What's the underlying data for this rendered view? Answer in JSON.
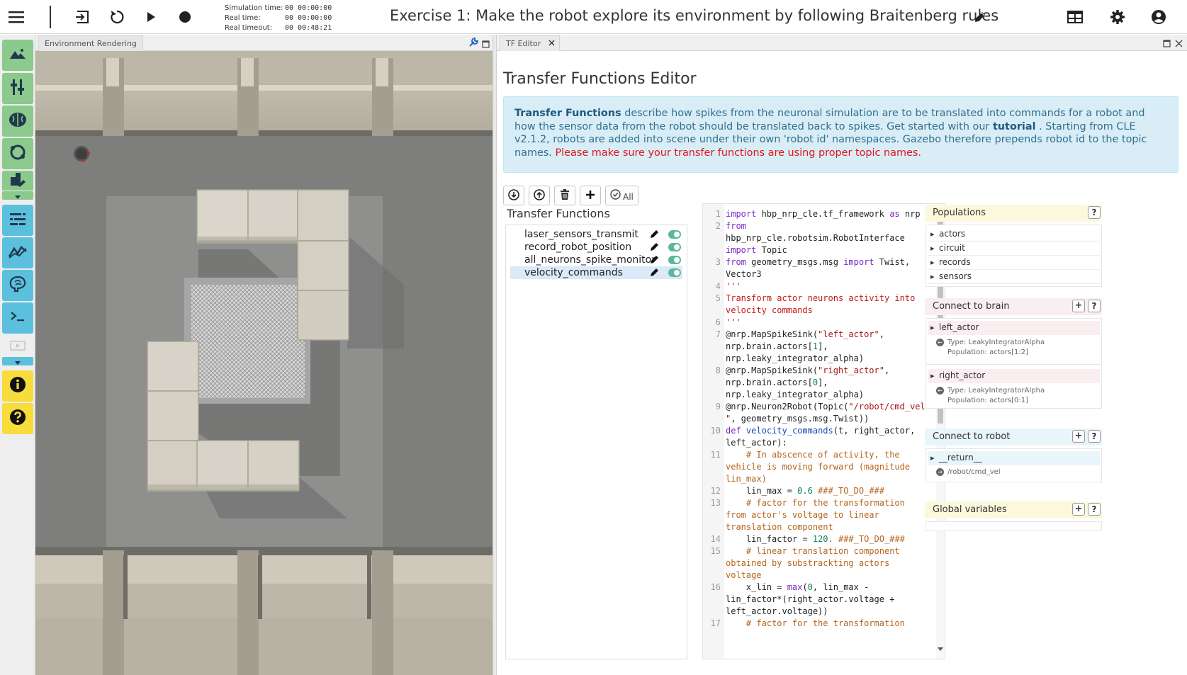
{
  "topbar": {
    "sim_time_label": "Simulation time:",
    "sim_time_value": "00 00:00:00",
    "real_time_label": "Real time:",
    "real_time_value": "00 00:00:00",
    "real_timeout_label": "Real timeout:",
    "real_timeout_value": "00 00:48:21",
    "title": "Exercise 1: Make the robot explore its environment by following Braitenberg rules",
    "icons": [
      "menu-icon",
      "exit-icon",
      "reset-icon",
      "play-icon",
      "record-icon",
      "pencil-icon",
      "layout-icon",
      "settings-icon",
      "account-icon"
    ]
  },
  "sidebar": {
    "buttons": [
      "environment-icon",
      "joints-icon",
      "brain-icon",
      "object-icon",
      "environment-editor-icon",
      "spike-train-icon",
      "plot-icon",
      "brain-visualizer-icon",
      "terminal-icon",
      "video-icon",
      "info-icon",
      "help-icon"
    ]
  },
  "environment": {
    "tab_label": "Environment Rendering"
  },
  "tf_editor": {
    "tab_label": "TF Editor",
    "heading": "Transfer Functions Editor",
    "info": {
      "strong": "Transfer Functions",
      "text1": " describe how spikes from the neuronal simulation are to be translated into commands for a robot and how the sensor data from the robot should be translated back to spikes. Get started with our ",
      "tutorial": "tutorial",
      "text2": " . Starting from CLE v2.1.2, robots are added into scene under their own 'robot id' namespaces. Gazebo therefore prepends robot id to the topic names. ",
      "warning": "Please make sure your transfer functions are using proper topic names."
    },
    "toolbar": {
      "all_label": "All"
    },
    "list_title": "Transfer Functions",
    "functions": [
      {
        "name": "laser_sensors_transmit",
        "selected": false
      },
      {
        "name": "record_robot_position",
        "selected": false
      },
      {
        "name": "all_neurons_spike_monitor",
        "selected": false
      },
      {
        "name": "velocity_commands",
        "selected": true
      }
    ],
    "code_line_numbers": [
      "1",
      "2",
      "",
      "3",
      "",
      "4",
      "5",
      "",
      "6",
      "7",
      "",
      "8",
      "",
      "9",
      "",
      "10",
      "",
      "11",
      "",
      "",
      "12",
      "13",
      "",
      "",
      "14",
      "15",
      "",
      "",
      "16",
      "",
      "",
      "17"
    ]
  },
  "populations": {
    "title": "Populations",
    "help": "?",
    "items": [
      "actors",
      "circuit",
      "records",
      "sensors"
    ]
  },
  "connect_brain": {
    "title": "Connect to brain",
    "plus": "+",
    "help": "?",
    "items": [
      {
        "name": "left_actor",
        "type": "Type: LeakyIntegratorAlpha",
        "population": "Population: actors[1:2]"
      },
      {
        "name": "right_actor",
        "type": "Type: LeakyIntegratorAlpha",
        "population": "Population: actors[0:1]"
      }
    ]
  },
  "connect_robot": {
    "title": "Connect to robot",
    "plus": "+",
    "help": "?",
    "items": [
      {
        "name": "__return__",
        "topic": "/robot/cmd_vel"
      }
    ]
  },
  "globals": {
    "title": "Global variables",
    "plus": "+",
    "help": "?"
  },
  "colors": {
    "sidebar_green": "#8cc98c",
    "sidebar_blue": "#5bc0de",
    "sidebar_yellow": "#f7dc3b",
    "info_bg": "#d9edf7",
    "populations_header": "#fcf8dc",
    "connect_brain_header": "#fbeef0",
    "connect_robot_header": "#e8f5fa",
    "globals_header": "#fcf8dc"
  }
}
